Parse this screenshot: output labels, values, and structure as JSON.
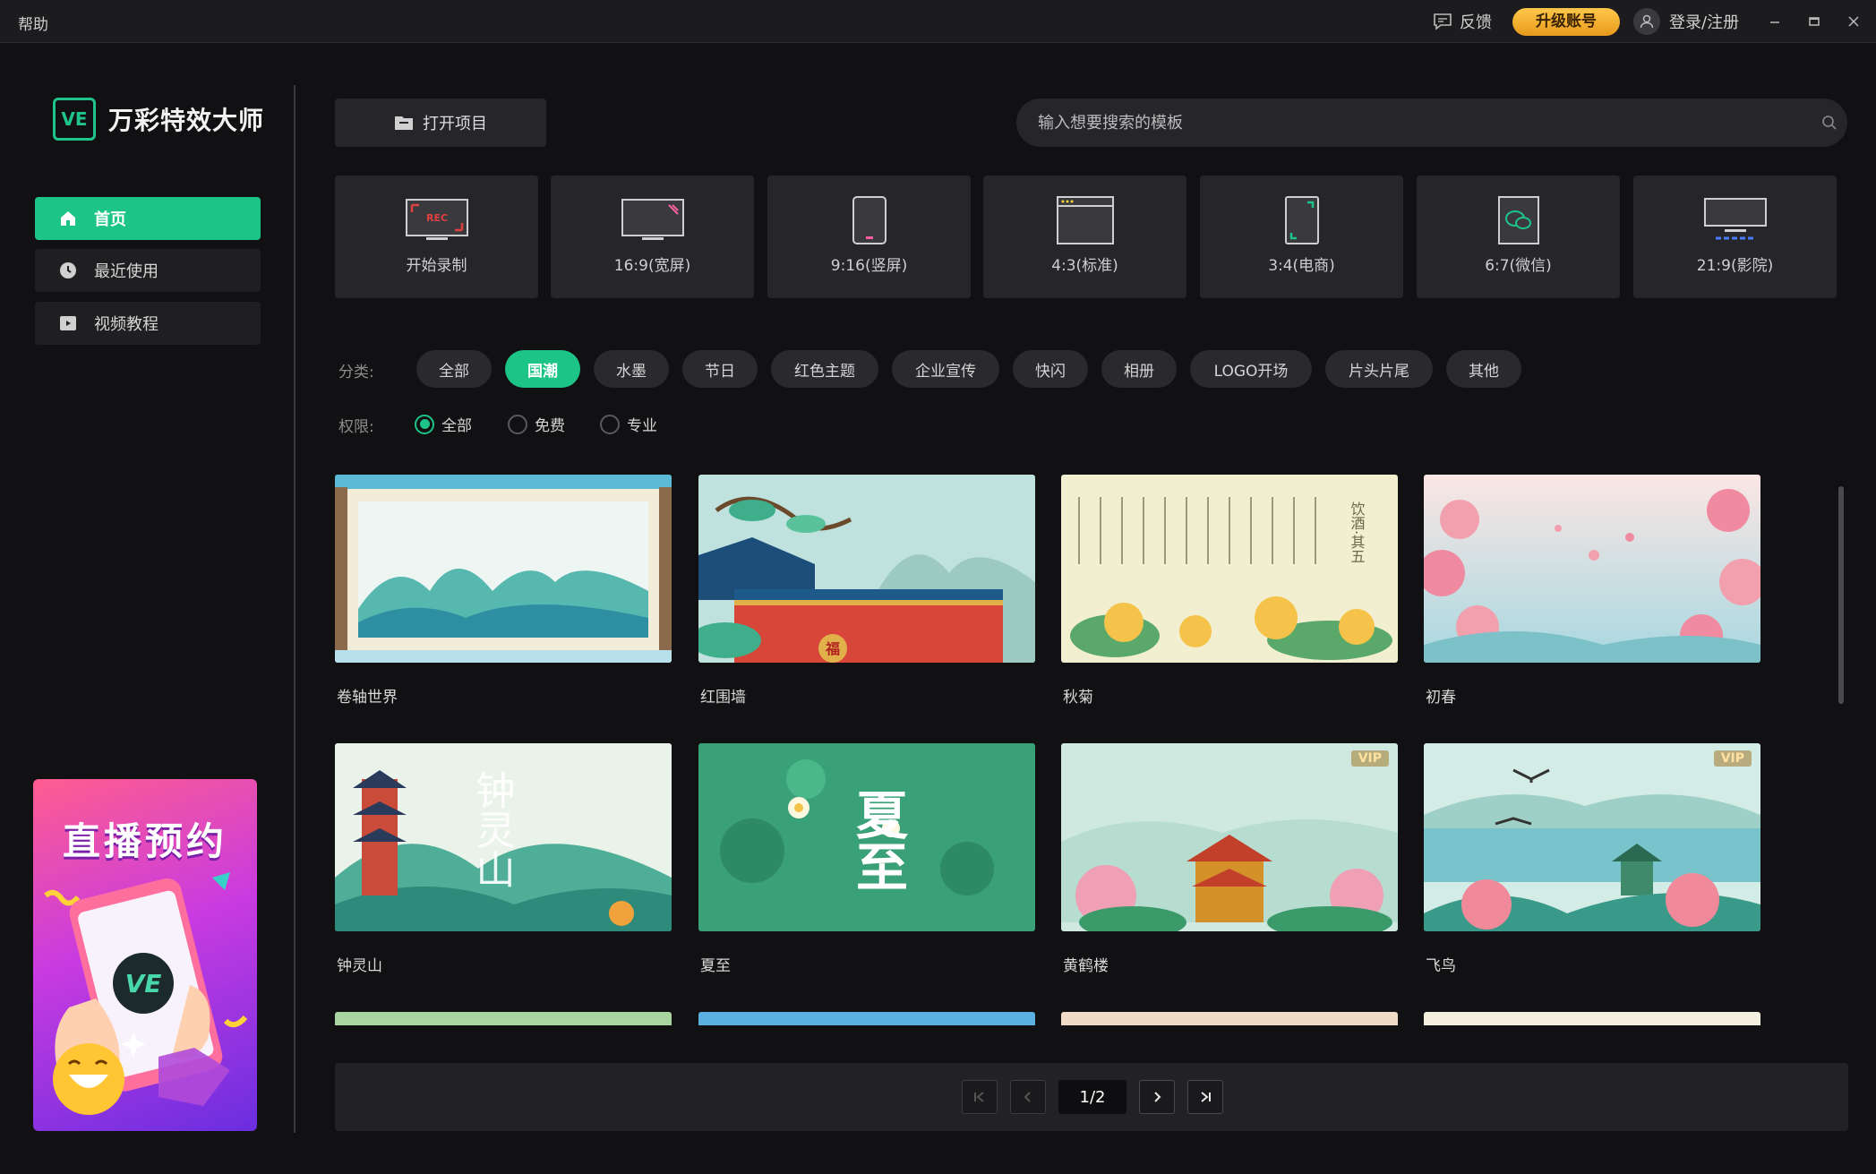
{
  "titlebar": {
    "help": "帮助",
    "feedback": "反馈",
    "upgrade": "升级账号",
    "login": "登录/注册",
    "min_icon": "minimize-icon",
    "max_icon": "maximize-icon",
    "close_icon": "close-icon"
  },
  "app": {
    "logo_mark": "VE",
    "name": "万彩特效大师",
    "accent": "#1dc488"
  },
  "sidebar": {
    "items": [
      {
        "label": "首页",
        "icon": "home-icon",
        "active": true
      },
      {
        "label": "最近使用",
        "icon": "clock-icon",
        "active": false
      },
      {
        "label": "视频教程",
        "icon": "video-icon",
        "active": false
      }
    ],
    "promo": {
      "title": "直播预约",
      "badge": "VE"
    }
  },
  "toolbar": {
    "open_project": "打开项目",
    "search_placeholder": "输入想要搜索的模板"
  },
  "ratios": [
    {
      "label": "开始录制",
      "icon": "record-icon"
    },
    {
      "label": "16:9(宽屏)",
      "icon": "widescreen-icon"
    },
    {
      "label": "9:16(竖屏)",
      "icon": "portrait-icon"
    },
    {
      "label": "4:3(标准)",
      "icon": "standard-icon"
    },
    {
      "label": "3:4(电商)",
      "icon": "ecommerce-icon"
    },
    {
      "label": "6:7(微信)",
      "icon": "wechat-icon"
    },
    {
      "label": "21:9(影院)",
      "icon": "cinema-icon"
    }
  ],
  "filters": {
    "category_label": "分类:",
    "categories": [
      "全部",
      "国潮",
      "水墨",
      "节日",
      "红色主题",
      "企业宣传",
      "快闪",
      "相册",
      "LOGO开场",
      "片头片尾",
      "其他"
    ],
    "active_category": "国潮",
    "permission_label": "权限:",
    "permissions": [
      "全部",
      "免费",
      "专业"
    ],
    "active_permission": "全部"
  },
  "templates": [
    {
      "title": "卷轴世界",
      "vip": false
    },
    {
      "title": "红围墙",
      "vip": false
    },
    {
      "title": "秋菊",
      "vip": false
    },
    {
      "title": "初春",
      "vip": false
    },
    {
      "title": "钟灵山",
      "vip": false
    },
    {
      "title": "夏至",
      "vip": false
    },
    {
      "title": "黄鹤楼",
      "vip": true,
      "vip_label": "VIP"
    },
    {
      "title": "飞鸟",
      "vip": true,
      "vip_label": "VIP"
    }
  ],
  "thumb_text": {
    "poem_title": "饮酒·其五",
    "hongweiqiang_char": "福",
    "zhonglingshan": "钟灵山",
    "xiazhi": "夏至"
  },
  "pagination": {
    "current": "1/2"
  }
}
